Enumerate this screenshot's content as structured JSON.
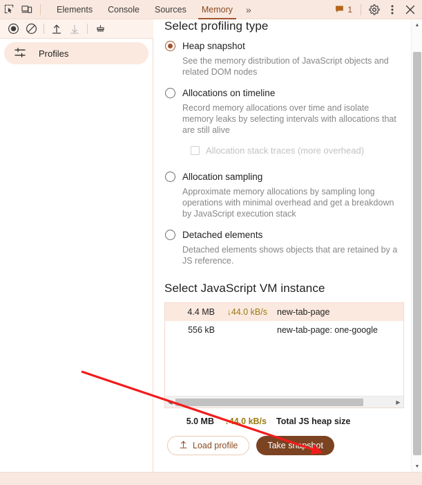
{
  "window": {
    "inspect_icon": "inspect-element-icon",
    "device_icon": "device-toolbar-icon",
    "more_tabs": "»",
    "issues_count": "1",
    "gear_icon": "gear-icon",
    "kebab_icon": "more-options-icon",
    "close_icon": "close-icon"
  },
  "tabs": [
    {
      "label": "Elements",
      "active": false
    },
    {
      "label": "Console",
      "active": false
    },
    {
      "label": "Sources",
      "active": false
    },
    {
      "label": "Memory",
      "active": true
    }
  ],
  "toolbar": {
    "record_icon": "record-icon",
    "clear_icon": "clear-icon",
    "load_icon": "upload-icon",
    "save_icon": "download-icon",
    "collect_garbage_icon": "collect-garbage-icon"
  },
  "sidebar": {
    "items": [
      {
        "label": "Profiles",
        "icon": "profiles-icon",
        "selected": true
      }
    ]
  },
  "main": {
    "profiling_heading": "Select profiling type",
    "options": [
      {
        "label": "Heap snapshot",
        "description": "See the memory distribution of JavaScript objects and related DOM nodes",
        "selected": true
      },
      {
        "label": "Allocations on timeline",
        "description": "Record memory allocations over time and isolate memory leaks by selecting intervals with allocations that are still alive",
        "selected": false,
        "suboption": {
          "label": "Allocation stack traces (more overhead)",
          "checked": false,
          "disabled": true
        }
      },
      {
        "label": "Allocation sampling",
        "description": "Approximate memory allocations by sampling long operations with minimal overhead and get a breakdown by JavaScript execution stack",
        "selected": false
      },
      {
        "label": "Detached elements",
        "description": "Detached elements shows objects that are retained by a JS reference.",
        "selected": false
      }
    ],
    "vm_heading": "Select JavaScript VM instance",
    "vm_rows": [
      {
        "size": "4.4 MB",
        "rate": "↓44.0 kB/s",
        "name": "new-tab-page",
        "selected": true
      },
      {
        "size": "556 kB",
        "rate": "",
        "name": "new-tab-page: one-google",
        "selected": false
      }
    ],
    "total": {
      "size": "5.0 MB",
      "rate": "↓44.0 kB/s",
      "label": "Total JS heap size"
    },
    "buttons": {
      "load_profile": "Load profile",
      "load_profile_icon": "upload-icon",
      "take_snapshot": "Take snapshot"
    }
  },
  "colors": {
    "accent": "#a0522d",
    "tabbar_bg": "#f8e8df",
    "selected_row": "#fbe9df",
    "filled_button": "#7b4322",
    "rate_text": "#9a7b12",
    "annotation_arrow": "#f21b1b"
  },
  "annotation": {
    "type": "arrow",
    "points_to": "take-snapshot-button"
  }
}
